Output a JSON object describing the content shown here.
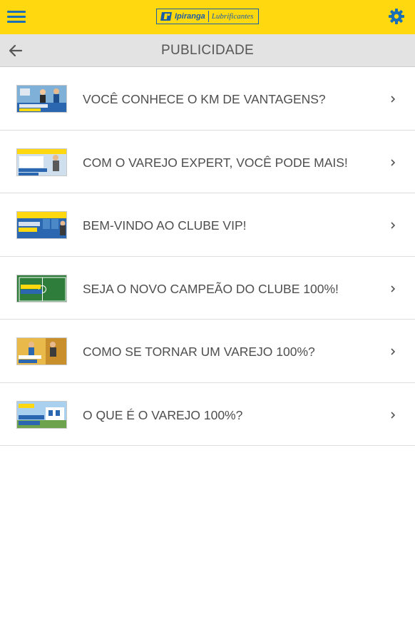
{
  "topbar": {
    "menu_icon": "hamburger-menu-icon",
    "settings_icon": "gear-icon",
    "logo": {
      "brand": "Ipiranga",
      "sub": "Lubrificantes"
    },
    "colors": {
      "background": "#ffd80f",
      "icons": "#1a6fb7"
    }
  },
  "header": {
    "back_icon": "arrow-left-icon",
    "title": "PUBLICIDADE"
  },
  "items": [
    {
      "label": "VOCÊ CONHECE O KM DE VANTAGENS?",
      "thumb_caption": "KM de Vantagens",
      "chevron_icon": "chevron-right-icon"
    },
    {
      "label": "COM O VAREJO EXPERT, VOCÊ PODE MAIS!",
      "thumb_caption": "Varejo Expert",
      "chevron_icon": "chevron-right-icon"
    },
    {
      "label": "BEM-VINDO AO CLUBE VIP!",
      "thumb_caption": "Clube VIP",
      "chevron_icon": "chevron-right-icon"
    },
    {
      "label": "SEJA O NOVO CAMPEÃO DO CLUBE 100%!",
      "thumb_caption": "do Clube 100%",
      "chevron_icon": "chevron-right-icon"
    },
    {
      "label": "COMO SE TORNAR UM VAREJO 100%?",
      "thumb_caption": "Varejo 100%",
      "chevron_icon": "chevron-right-icon"
    },
    {
      "label": "O QUE É O VAREJO 100%?",
      "thumb_caption": "para o seu PDV",
      "chevron_icon": "chevron-right-icon"
    }
  ]
}
